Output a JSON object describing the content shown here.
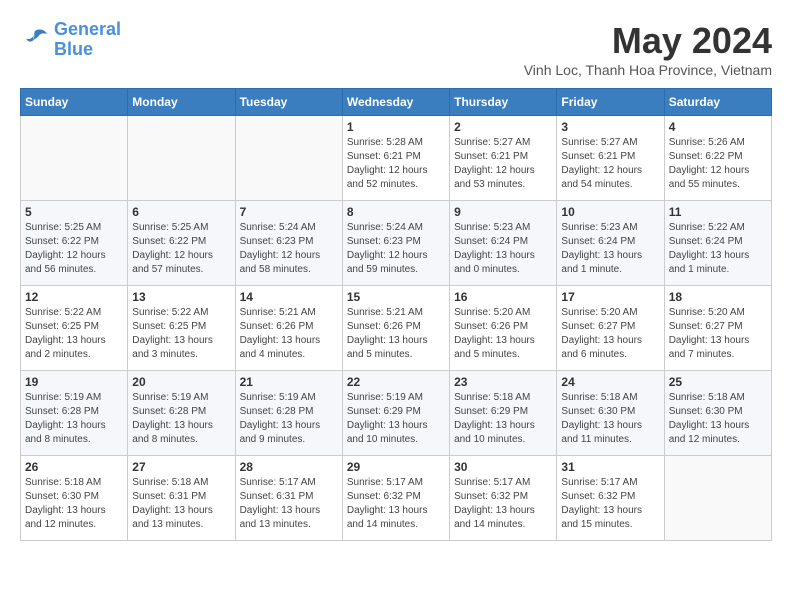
{
  "logo": {
    "line1": "General",
    "line2": "Blue"
  },
  "title": {
    "month_year": "May 2024",
    "location": "Vinh Loc, Thanh Hoa Province, Vietnam"
  },
  "days_of_week": [
    "Sunday",
    "Monday",
    "Tuesday",
    "Wednesday",
    "Thursday",
    "Friday",
    "Saturday"
  ],
  "weeks": [
    [
      {
        "day": "",
        "info": ""
      },
      {
        "day": "",
        "info": ""
      },
      {
        "day": "",
        "info": ""
      },
      {
        "day": "1",
        "info": "Sunrise: 5:28 AM\nSunset: 6:21 PM\nDaylight: 12 hours\nand 52 minutes."
      },
      {
        "day": "2",
        "info": "Sunrise: 5:27 AM\nSunset: 6:21 PM\nDaylight: 12 hours\nand 53 minutes."
      },
      {
        "day": "3",
        "info": "Sunrise: 5:27 AM\nSunset: 6:21 PM\nDaylight: 12 hours\nand 54 minutes."
      },
      {
        "day": "4",
        "info": "Sunrise: 5:26 AM\nSunset: 6:22 PM\nDaylight: 12 hours\nand 55 minutes."
      }
    ],
    [
      {
        "day": "5",
        "info": "Sunrise: 5:25 AM\nSunset: 6:22 PM\nDaylight: 12 hours\nand 56 minutes."
      },
      {
        "day": "6",
        "info": "Sunrise: 5:25 AM\nSunset: 6:22 PM\nDaylight: 12 hours\nand 57 minutes."
      },
      {
        "day": "7",
        "info": "Sunrise: 5:24 AM\nSunset: 6:23 PM\nDaylight: 12 hours\nand 58 minutes."
      },
      {
        "day": "8",
        "info": "Sunrise: 5:24 AM\nSunset: 6:23 PM\nDaylight: 12 hours\nand 59 minutes."
      },
      {
        "day": "9",
        "info": "Sunrise: 5:23 AM\nSunset: 6:24 PM\nDaylight: 13 hours\nand 0 minutes."
      },
      {
        "day": "10",
        "info": "Sunrise: 5:23 AM\nSunset: 6:24 PM\nDaylight: 13 hours\nand 1 minute."
      },
      {
        "day": "11",
        "info": "Sunrise: 5:22 AM\nSunset: 6:24 PM\nDaylight: 13 hours\nand 1 minute."
      }
    ],
    [
      {
        "day": "12",
        "info": "Sunrise: 5:22 AM\nSunset: 6:25 PM\nDaylight: 13 hours\nand 2 minutes."
      },
      {
        "day": "13",
        "info": "Sunrise: 5:22 AM\nSunset: 6:25 PM\nDaylight: 13 hours\nand 3 minutes."
      },
      {
        "day": "14",
        "info": "Sunrise: 5:21 AM\nSunset: 6:26 PM\nDaylight: 13 hours\nand 4 minutes."
      },
      {
        "day": "15",
        "info": "Sunrise: 5:21 AM\nSunset: 6:26 PM\nDaylight: 13 hours\nand 5 minutes."
      },
      {
        "day": "16",
        "info": "Sunrise: 5:20 AM\nSunset: 6:26 PM\nDaylight: 13 hours\nand 5 minutes."
      },
      {
        "day": "17",
        "info": "Sunrise: 5:20 AM\nSunset: 6:27 PM\nDaylight: 13 hours\nand 6 minutes."
      },
      {
        "day": "18",
        "info": "Sunrise: 5:20 AM\nSunset: 6:27 PM\nDaylight: 13 hours\nand 7 minutes."
      }
    ],
    [
      {
        "day": "19",
        "info": "Sunrise: 5:19 AM\nSunset: 6:28 PM\nDaylight: 13 hours\nand 8 minutes."
      },
      {
        "day": "20",
        "info": "Sunrise: 5:19 AM\nSunset: 6:28 PM\nDaylight: 13 hours\nand 8 minutes."
      },
      {
        "day": "21",
        "info": "Sunrise: 5:19 AM\nSunset: 6:28 PM\nDaylight: 13 hours\nand 9 minutes."
      },
      {
        "day": "22",
        "info": "Sunrise: 5:19 AM\nSunset: 6:29 PM\nDaylight: 13 hours\nand 10 minutes."
      },
      {
        "day": "23",
        "info": "Sunrise: 5:18 AM\nSunset: 6:29 PM\nDaylight: 13 hours\nand 10 minutes."
      },
      {
        "day": "24",
        "info": "Sunrise: 5:18 AM\nSunset: 6:30 PM\nDaylight: 13 hours\nand 11 minutes."
      },
      {
        "day": "25",
        "info": "Sunrise: 5:18 AM\nSunset: 6:30 PM\nDaylight: 13 hours\nand 12 minutes."
      }
    ],
    [
      {
        "day": "26",
        "info": "Sunrise: 5:18 AM\nSunset: 6:30 PM\nDaylight: 13 hours\nand 12 minutes."
      },
      {
        "day": "27",
        "info": "Sunrise: 5:18 AM\nSunset: 6:31 PM\nDaylight: 13 hours\nand 13 minutes."
      },
      {
        "day": "28",
        "info": "Sunrise: 5:17 AM\nSunset: 6:31 PM\nDaylight: 13 hours\nand 13 minutes."
      },
      {
        "day": "29",
        "info": "Sunrise: 5:17 AM\nSunset: 6:32 PM\nDaylight: 13 hours\nand 14 minutes."
      },
      {
        "day": "30",
        "info": "Sunrise: 5:17 AM\nSunset: 6:32 PM\nDaylight: 13 hours\nand 14 minutes."
      },
      {
        "day": "31",
        "info": "Sunrise: 5:17 AM\nSunset: 6:32 PM\nDaylight: 13 hours\nand 15 minutes."
      },
      {
        "day": "",
        "info": ""
      }
    ]
  ]
}
